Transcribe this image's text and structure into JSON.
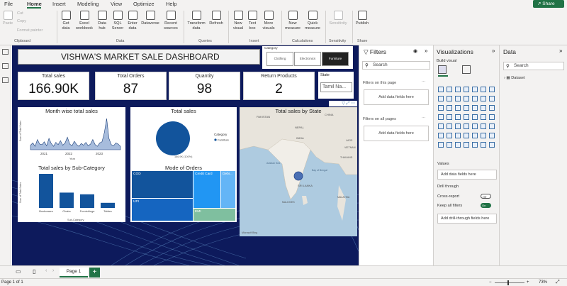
{
  "menu": {
    "items": [
      "File",
      "Home",
      "Insert",
      "Modeling",
      "View",
      "Optimize",
      "Help"
    ],
    "share": "Share"
  },
  "ribbon": {
    "paste": "Paste",
    "cut": "Cut",
    "copy": "Copy",
    "format_painter": "Format painter",
    "clipboard": "Clipboard",
    "get_data": "Get data",
    "excel": "Excel workbook",
    "data_hub": "Data hub",
    "sql": "SQL Server",
    "enter": "Enter data",
    "dataverse": "Dataverse",
    "recent": "Recent sources",
    "data": "Data",
    "transform": "Transform data",
    "refresh": "Refresh",
    "queries": "Queries",
    "new_visual": "New visual",
    "text_box": "Text box",
    "more_visuals": "More visuals",
    "insert": "Insert",
    "new_measure": "New measure",
    "quick_measure": "Quick measure",
    "calculations": "Calculations",
    "sensitivity": "Sensitivity",
    "sensitivity_grp": "Sensitivity",
    "publish": "Publish",
    "share_grp": "Share"
  },
  "dashboard": {
    "title": "VISHWA'S MARKET SALE DASHBOARD",
    "category_label": "Category",
    "categories": [
      "Clothing",
      "Electronics",
      "Furniture"
    ],
    "selected_category": "Furniture",
    "kpis": [
      {
        "label": "Total sales",
        "value": "166.90K"
      },
      {
        "label": "Total Orders",
        "value": "87"
      },
      {
        "label": "Quantity",
        "value": "98"
      },
      {
        "label": "Return Products",
        "value": "2"
      }
    ],
    "state_label": "State",
    "state_value": "Tamil Na...",
    "month_title": "Month wise total sales",
    "month_years": [
      "2021",
      "2022",
      "2023"
    ],
    "month_xlabel": "Year",
    "month_ylabel": "Sum of Total Sales",
    "sales_title": "Total sales",
    "sales_legend_title": "Category",
    "sales_legend_item": "Furniture",
    "sales_pie_label": "166.9K (100%)",
    "map_title": "Total sales by State",
    "map_labels": [
      "PAKISTAN",
      "CHINA",
      "NEPAL",
      "INDIA",
      "Arabian Sea",
      "Bay of Bengal",
      "SRI LANKA",
      "THAILAND",
      "LAOS",
      "VIETNAM",
      "MALAYSIA",
      "MALDIVES"
    ],
    "map_credit": "Microsoft Bing",
    "subcat_title": "Total sales by Sub-Category",
    "subcat_xlabel": "Sub-Category",
    "subcat_ylabel": "Sum of Total Sales",
    "mode_title": "Mode of Orders",
    "mode_cells": [
      "COD",
      "Credit Card",
      "Debi...",
      "UPI",
      "EMI"
    ]
  },
  "chart_data": [
    {
      "type": "pie",
      "title": "Total sales",
      "legend_title": "Category",
      "slices": [
        {
          "name": "Furniture",
          "value": 166.9,
          "label": "166.9K (100%)"
        }
      ],
      "color": "#12549c"
    },
    {
      "type": "bar",
      "title": "Total sales by Sub-Category",
      "categories": [
        "Bookcases",
        "Chairs",
        "Furnishings",
        "Tables"
      ],
      "values": [
        100,
        45,
        40,
        15
      ],
      "xlabel": "Sub-Category",
      "ylabel": "Sum of Total Sales",
      "color": "#12549c"
    },
    {
      "type": "area",
      "title": "Month wise total sales",
      "x_ticks": [
        "2021",
        "2022",
        "2023"
      ],
      "xlabel": "Year",
      "ylabel": "Sum of Total Sales",
      "values": [
        8,
        12,
        6,
        18,
        10,
        9,
        14,
        7,
        20,
        11,
        6,
        13,
        9,
        16,
        8,
        12,
        22,
        10,
        7,
        15,
        9,
        6,
        11,
        8,
        13,
        7,
        10,
        18,
        9,
        6,
        12,
        14,
        30,
        55,
        20,
        9,
        7,
        12,
        10,
        6
      ]
    },
    {
      "type": "table",
      "title": "Mode of Orders",
      "cells": [
        {
          "name": "COD",
          "value": 40
        },
        {
          "name": "UPI",
          "value": 22
        },
        {
          "name": "Credit Card",
          "value": 25
        },
        {
          "name": "Debi...",
          "value": 8
        },
        {
          "name": "EMI",
          "value": 5
        }
      ]
    }
  ],
  "filters": {
    "title": "Filters",
    "search": "Search",
    "on_page": "Filters on this page",
    "on_all": "Filters on all pages",
    "add": "Add data fields here"
  },
  "viz": {
    "title": "Visualizations",
    "build": "Build visual",
    "values": "Values",
    "add_fields": "Add data fields here",
    "drill": "Drill through",
    "cross": "Cross-report",
    "keep": "Keep all filters",
    "add_drill": "Add drill-through fields here",
    "off": "Off",
    "on": "On"
  },
  "data_pane": {
    "title": "Data",
    "search": "Search",
    "dataset": "Dataset"
  },
  "pages": {
    "page1": "Page 1"
  },
  "status": {
    "page": "Page 1 of 1",
    "zoom": "73%"
  }
}
